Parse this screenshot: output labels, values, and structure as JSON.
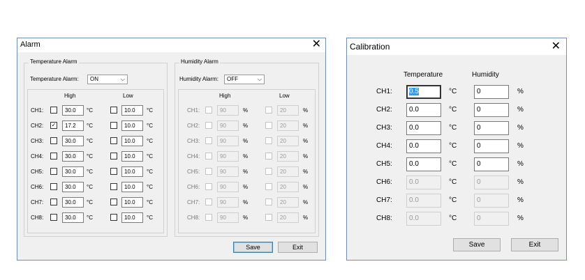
{
  "alarm": {
    "title": "Alarm",
    "close": "✕",
    "temperature": {
      "group_label": "Temperature Alarm",
      "alarm_label": "Temperature Alarm:",
      "alarm_value": "ON",
      "high_header": "High",
      "low_header": "Low",
      "unit": "°C",
      "rows": [
        {
          "ch": "CH1:",
          "high_checked": false,
          "high": "30.0",
          "low_checked": false,
          "low": "10.0"
        },
        {
          "ch": "CH2:",
          "high_checked": true,
          "high": "17.2",
          "low_checked": false,
          "low": "10.0"
        },
        {
          "ch": "CH3:",
          "high_checked": false,
          "high": "30.0",
          "low_checked": false,
          "low": "10.0"
        },
        {
          "ch": "CH4:",
          "high_checked": false,
          "high": "30.0",
          "low_checked": false,
          "low": "10.0"
        },
        {
          "ch": "CH5:",
          "high_checked": false,
          "high": "30.0",
          "low_checked": false,
          "low": "10.0"
        },
        {
          "ch": "CH6:",
          "high_checked": false,
          "high": "30.0",
          "low_checked": false,
          "low": "10.0"
        },
        {
          "ch": "CH7:",
          "high_checked": false,
          "high": "30.0",
          "low_checked": false,
          "low": "10.0"
        },
        {
          "ch": "CH8:",
          "high_checked": false,
          "high": "30.0",
          "low_checked": false,
          "low": "10.0"
        }
      ]
    },
    "humidity": {
      "group_label": "Humidity Alarm",
      "alarm_label": "Humidity Alarm:",
      "alarm_value": "OFF",
      "high_header": "High",
      "low_header": "Low",
      "unit": "%",
      "rows": [
        {
          "ch": "CH1:",
          "high": "90",
          "low": "20"
        },
        {
          "ch": "CH2:",
          "high": "90",
          "low": "20"
        },
        {
          "ch": "CH3:",
          "high": "90",
          "low": "20"
        },
        {
          "ch": "CH4:",
          "high": "90",
          "low": "20"
        },
        {
          "ch": "CH5:",
          "high": "90",
          "low": "20"
        },
        {
          "ch": "CH6:",
          "high": "90",
          "low": "20"
        },
        {
          "ch": "CH7:",
          "high": "90",
          "low": "20"
        },
        {
          "ch": "CH8:",
          "high": "90",
          "low": "20"
        }
      ]
    },
    "save_label": "Save",
    "exit_label": "Exit"
  },
  "calibration": {
    "title": "Calibration",
    "close": "✕",
    "temperature_header": "Temperature",
    "humidity_header": "Humidity",
    "temp_unit": "°C",
    "hum_unit": "%",
    "rows": [
      {
        "ch": "CH1:",
        "temp": "0.5",
        "hum": "0",
        "enabled": true
      },
      {
        "ch": "CH2:",
        "temp": "0.0",
        "hum": "0",
        "enabled": true
      },
      {
        "ch": "CH3:",
        "temp": "0.0",
        "hum": "0",
        "enabled": true
      },
      {
        "ch": "CH4:",
        "temp": "0.0",
        "hum": "0",
        "enabled": true
      },
      {
        "ch": "CH5:",
        "temp": "0.0",
        "hum": "0",
        "enabled": true
      },
      {
        "ch": "CH6:",
        "temp": "0.0",
        "hum": "0",
        "enabled": false
      },
      {
        "ch": "CH7:",
        "temp": "0.0",
        "hum": "0",
        "enabled": false
      },
      {
        "ch": "CH8:",
        "temp": "0.0",
        "hum": "0",
        "enabled": false
      }
    ],
    "save_label": "Save",
    "exit_label": "Exit"
  }
}
